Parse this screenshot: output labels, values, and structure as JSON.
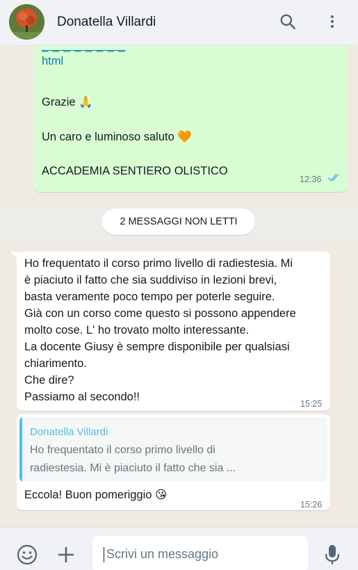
{
  "header": {
    "contact_name": "Donatella Villardi",
    "icons": [
      "search-icon",
      "more-vert-icon"
    ]
  },
  "messages": {
    "outgoing": {
      "link_fragment": "_ _ _ _ _ _ _ _",
      "link_end": "html",
      "thanks": "Grazie 🙏",
      "greeting": "Un caro e luminoso saluto 🧡",
      "signature": "ACCADEMIA SENTIERO OLISTICO",
      "time": "12:36",
      "status": "read"
    },
    "unread_divider": "2 MESSAGGI NON LETTI",
    "incoming_1": {
      "text": "Ho frequentato il corso primo livello di radiestesia. Mi\nè piaciuto il fatto che sia suddiviso in lezioni brevi,\nbasta veramente poco tempo per poterle seguire.\nGià con un corso come questo si possono appendere\nmolto cose. L' ho trovato molto interessante.\nLa docente Giusy è sempre disponibile per qualsiasi\nchiarimento.\nChe dire?\nPassiamo al secondo!!",
      "time": "15:25"
    },
    "incoming_2": {
      "quoted_author": "Donatella Villardi",
      "quoted_text": "Ho frequentato il corso primo livello di\nradiestesia. Mi è piaciuto il fatto che sia ...",
      "text": "Eccola! Buon pomeriggio 😘",
      "time": "15:26"
    }
  },
  "footer": {
    "placeholder": "Scrivi un messaggio",
    "icons": [
      "emoji-icon",
      "plus-icon",
      "mic-icon"
    ]
  },
  "colors": {
    "outgoing_bubble": "#d9fdd3",
    "incoming_bubble": "#ffffff",
    "accent_blue": "#53bdeb",
    "link": "#027eb5"
  }
}
